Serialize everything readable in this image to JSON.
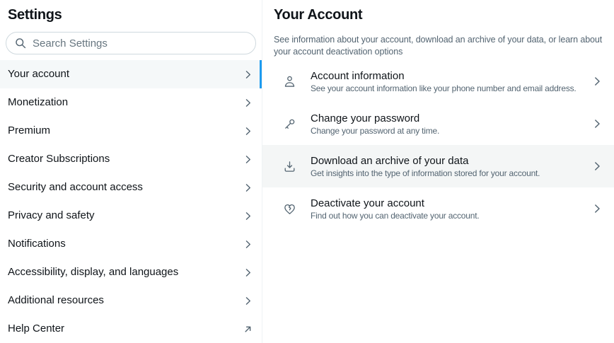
{
  "sidebar": {
    "title": "Settings",
    "search": {
      "placeholder": "Search Settings",
      "icon": "search-icon"
    },
    "items": [
      {
        "label": "Your account",
        "selected": true,
        "trailing_icon": "chevron-right-icon"
      },
      {
        "label": "Monetization",
        "selected": false,
        "trailing_icon": "chevron-right-icon"
      },
      {
        "label": "Premium",
        "selected": false,
        "trailing_icon": "chevron-right-icon"
      },
      {
        "label": "Creator Subscriptions",
        "selected": false,
        "trailing_icon": "chevron-right-icon"
      },
      {
        "label": "Security and account access",
        "selected": false,
        "trailing_icon": "chevron-right-icon"
      },
      {
        "label": "Privacy and safety",
        "selected": false,
        "trailing_icon": "chevron-right-icon"
      },
      {
        "label": "Notifications",
        "selected": false,
        "trailing_icon": "chevron-right-icon"
      },
      {
        "label": "Accessibility, display, and languages",
        "selected": false,
        "trailing_icon": "chevron-right-icon"
      },
      {
        "label": "Additional resources",
        "selected": false,
        "trailing_icon": "chevron-right-icon"
      },
      {
        "label": "Help Center",
        "selected": false,
        "trailing_icon": "external-link-icon"
      }
    ]
  },
  "main": {
    "title": "Your Account",
    "description": "See information about your account, download an archive of your data, or learn about your account deactivation options",
    "items": [
      {
        "icon": "person-icon",
        "title": "Account information",
        "subtitle": "See your account information like your phone number and email address.",
        "highlighted": false,
        "trailing_icon": "chevron-right-icon"
      },
      {
        "icon": "key-icon",
        "title": "Change your password",
        "subtitle": "Change your password at any time.",
        "highlighted": false,
        "trailing_icon": "chevron-right-icon"
      },
      {
        "icon": "download-icon",
        "title": "Download an archive of your data",
        "subtitle": "Get insights into the type of information stored for your account.",
        "highlighted": true,
        "trailing_icon": "chevron-right-icon"
      },
      {
        "icon": "heart-broken-icon",
        "title": "Deactivate your account",
        "subtitle": "Find out how you can deactivate your account.",
        "highlighted": false,
        "trailing_icon": "chevron-right-icon"
      }
    ]
  },
  "colors": {
    "accent_blue": "#1d9bf0",
    "text_primary": "#0f1419",
    "text_secondary": "#536471",
    "divider": "#eff3f4",
    "selected_row_bg": "#f5f8f9",
    "hover_row_bg": "#f4f6f6",
    "search_border": "#cfd9de"
  }
}
